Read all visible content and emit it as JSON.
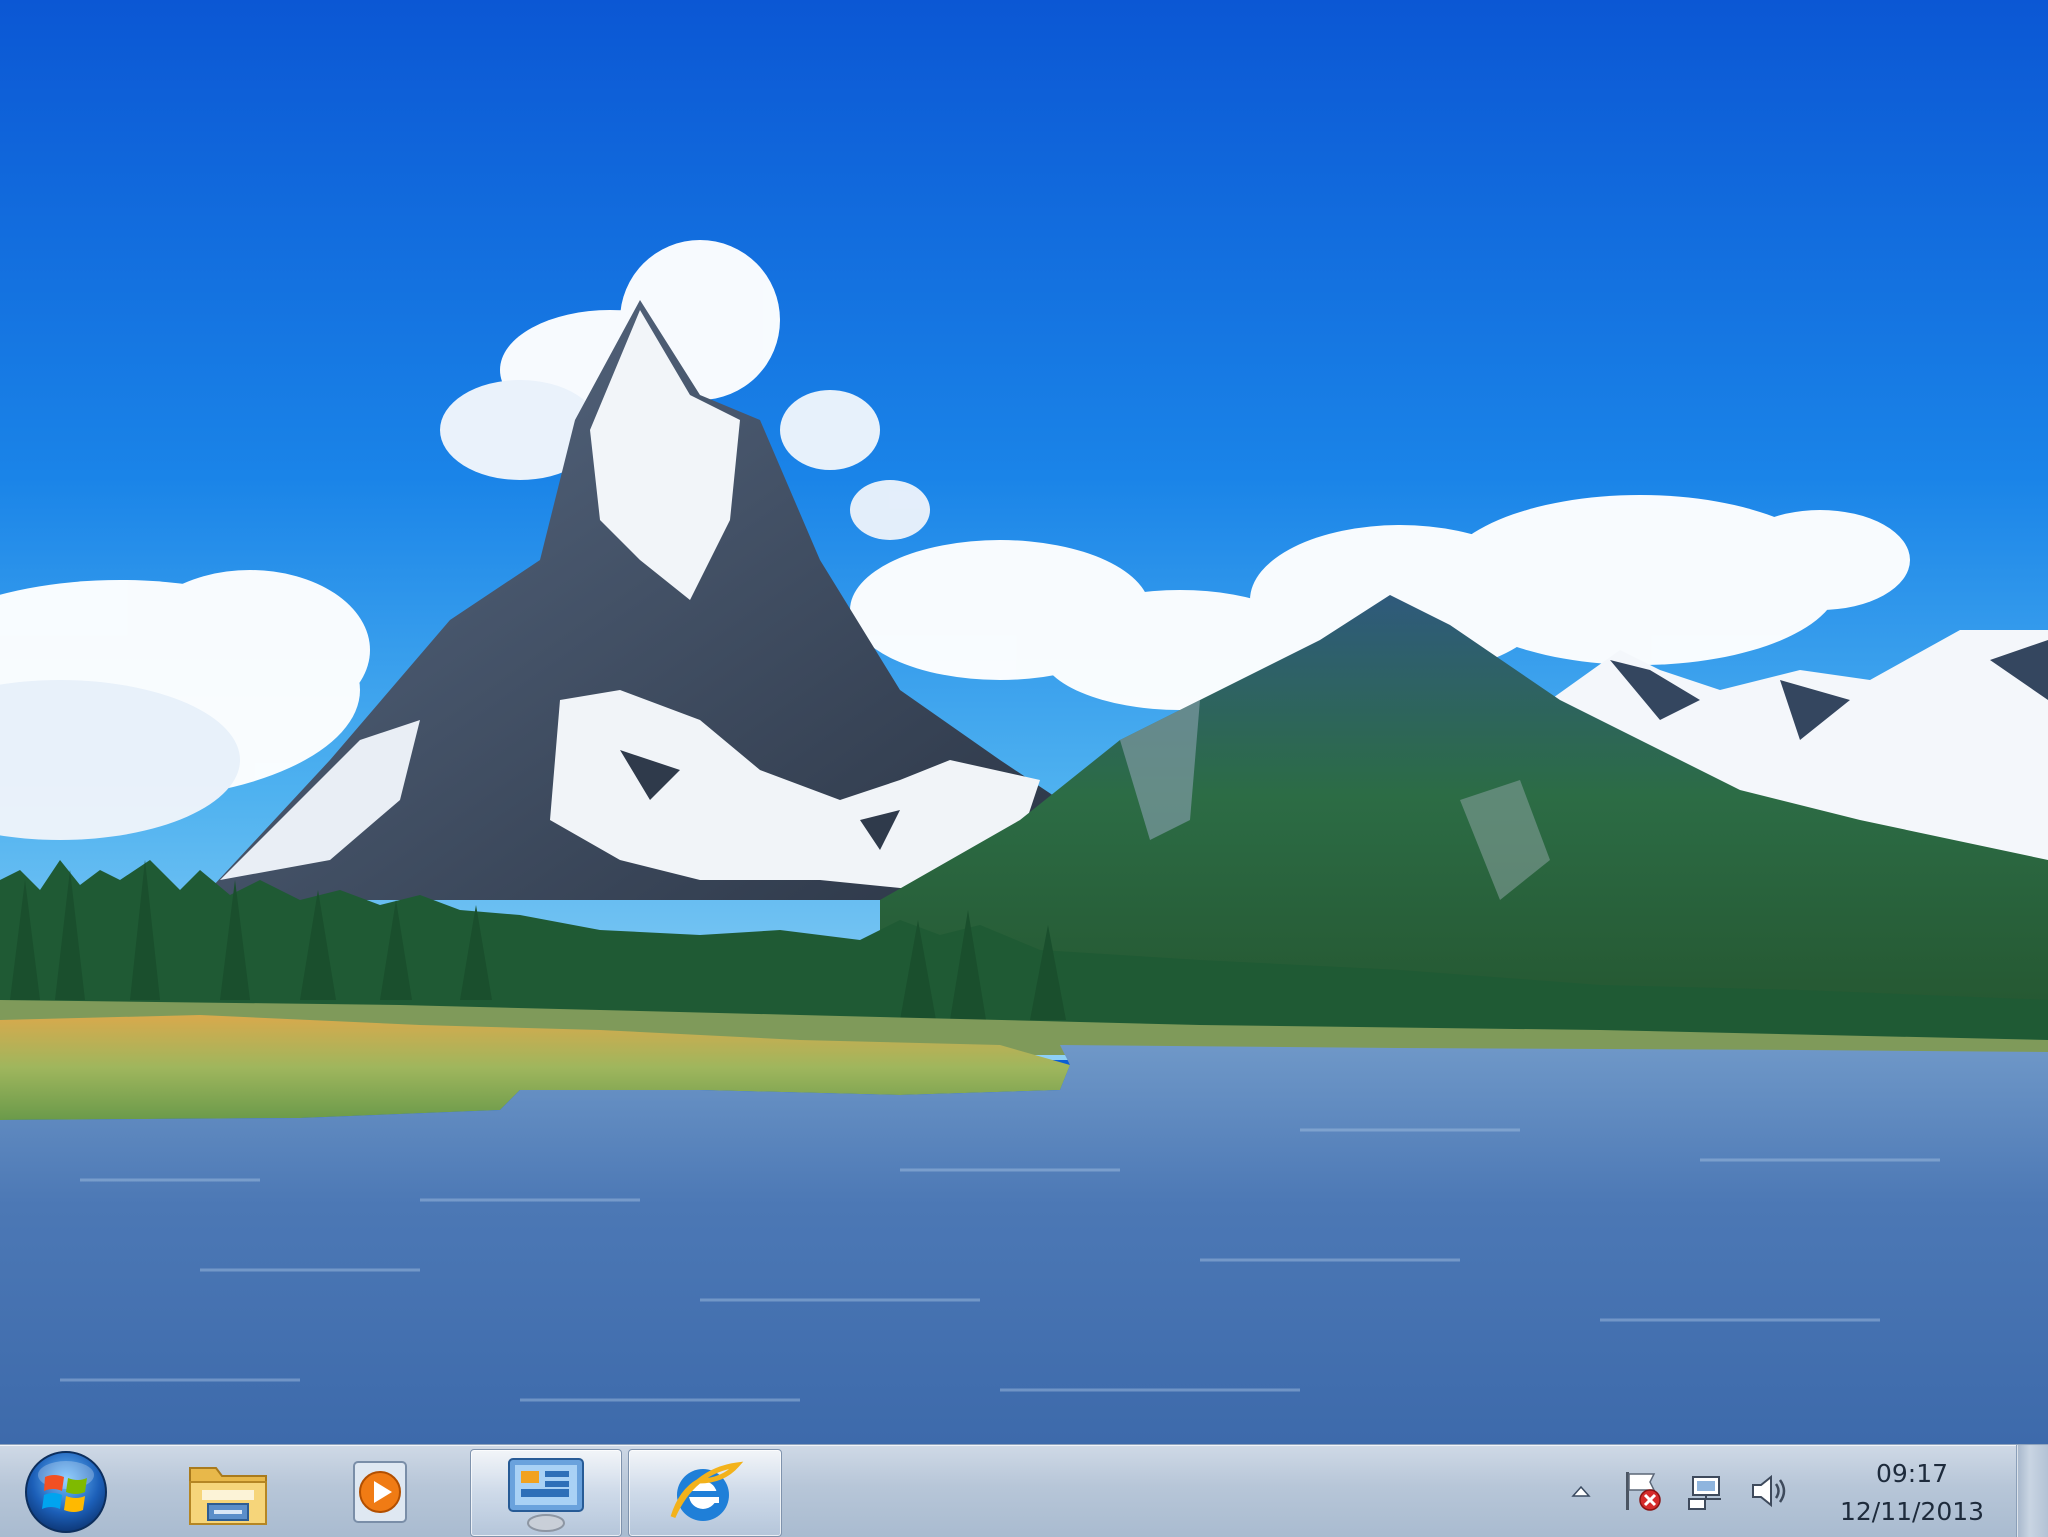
{
  "desktop": {
    "wallpaper": "mountain-lake-landscape"
  },
  "taskbar": {
    "start_button": "windows-logo-icon",
    "pinned": [
      {
        "name": "Windows Explorer",
        "icon": "folder-icon",
        "running": false
      },
      {
        "name": "Windows Media Player",
        "icon": "media-player-icon",
        "running": false
      },
      {
        "name": "Control Panel",
        "icon": "control-panel-icon",
        "running": true
      },
      {
        "name": "Internet Explorer",
        "icon": "internet-explorer-icon",
        "running": true
      }
    ],
    "tray": {
      "icons": [
        "show-hidden-icons-arrow-icon",
        "action-center-flag-icon",
        "network-icon",
        "volume-icon"
      ]
    },
    "clock": {
      "time": "09:17",
      "date": "12/11/2013"
    }
  },
  "colors": {
    "sky_top": "#0b5fd6",
    "sky_bottom": "#33a2ee",
    "water": "#4a78b4",
    "forest": "#2d6b3a",
    "taskbar": "#b7c6d8"
  }
}
